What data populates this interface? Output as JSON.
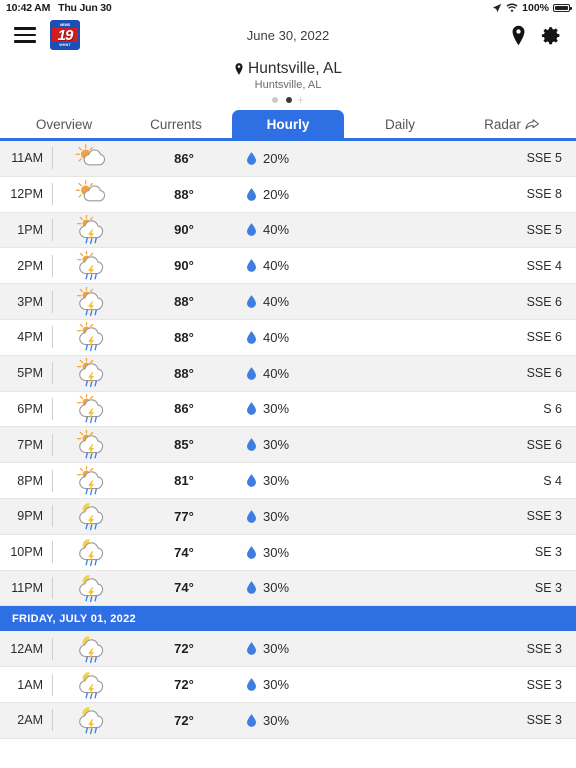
{
  "status_bar": {
    "time": "10:42 AM",
    "date": "Thu Jun 30",
    "battery_percent": "100%",
    "location_icon": "location-arrow-icon",
    "wifi_icon": "wifi-icon",
    "battery_icon": "battery-icon"
  },
  "app_bar": {
    "menu_icon": "hamburger-menu-icon",
    "logo": {
      "network": "NEWS",
      "number": "19",
      "callsign": "WHNT"
    },
    "date": "June 30, 2022",
    "pin_icon": "map-pin-icon",
    "settings_icon": "gear-icon"
  },
  "location": {
    "pin_icon": "location-pin-icon",
    "name": "Huntsville, AL",
    "subtitle": "Huntsville, AL",
    "pages": [
      {
        "active": false
      },
      {
        "active": true
      }
    ],
    "add_label": "+"
  },
  "tabs": [
    {
      "label": "Overview",
      "active": false,
      "icon": null
    },
    {
      "label": "Currents",
      "active": false,
      "icon": null
    },
    {
      "label": "Hourly",
      "active": true,
      "icon": null
    },
    {
      "label": "Daily",
      "active": false,
      "icon": null
    },
    {
      "label": "Radar",
      "active": false,
      "icon": "share-arrow-icon"
    }
  ],
  "accent_color": "#2f6fe4",
  "precip_drop_color": "#3d7fe0",
  "sun_color": "#f5a13c",
  "moon_color": "#f2d24b",
  "bolt_color": "#f5c026",
  "hourly": [
    {
      "time": "11AM",
      "icon": "sun-cloud",
      "temp": "86°",
      "precip": "20%",
      "wind": "SSE 5"
    },
    {
      "time": "12PM",
      "icon": "sun-cloud",
      "temp": "88°",
      "precip": "20%",
      "wind": "SSE 8"
    },
    {
      "time": "1PM",
      "icon": "sun-cloud-storm",
      "temp": "90°",
      "precip": "40%",
      "wind": "SSE 5"
    },
    {
      "time": "2PM",
      "icon": "sun-cloud-storm",
      "temp": "90°",
      "precip": "40%",
      "wind": "SSE 4"
    },
    {
      "time": "3PM",
      "icon": "sun-cloud-storm",
      "temp": "88°",
      "precip": "40%",
      "wind": "SSE 6"
    },
    {
      "time": "4PM",
      "icon": "sun-cloud-storm",
      "temp": "88°",
      "precip": "40%",
      "wind": "SSE 6"
    },
    {
      "time": "5PM",
      "icon": "sun-cloud-storm",
      "temp": "88°",
      "precip": "40%",
      "wind": "SSE 6"
    },
    {
      "time": "6PM",
      "icon": "sun-cloud-storm",
      "temp": "86°",
      "precip": "30%",
      "wind": "S 6"
    },
    {
      "time": "7PM",
      "icon": "sun-cloud-storm",
      "temp": "85°",
      "precip": "30%",
      "wind": "SSE 6"
    },
    {
      "time": "8PM",
      "icon": "sun-cloud-storm",
      "temp": "81°",
      "precip": "30%",
      "wind": "S 4"
    },
    {
      "time": "9PM",
      "icon": "moon-cloud-storm",
      "temp": "77°",
      "precip": "30%",
      "wind": "SSE 3"
    },
    {
      "time": "10PM",
      "icon": "moon-cloud-storm",
      "temp": "74°",
      "precip": "30%",
      "wind": "SE 3"
    },
    {
      "time": "11PM",
      "icon": "moon-cloud-storm",
      "temp": "74°",
      "precip": "30%",
      "wind": "SE 3"
    }
  ],
  "day_header": "FRIDAY, JULY 01, 2022",
  "hourly_next_day": [
    {
      "time": "12AM",
      "icon": "moon-cloud-storm",
      "temp": "72°",
      "precip": "30%",
      "wind": "SSE 3"
    },
    {
      "time": "1AM",
      "icon": "moon-cloud-storm",
      "temp": "72°",
      "precip": "30%",
      "wind": "SSE 3"
    },
    {
      "time": "2AM",
      "icon": "moon-cloud-storm",
      "temp": "72°",
      "precip": "30%",
      "wind": "SSE 3"
    }
  ]
}
